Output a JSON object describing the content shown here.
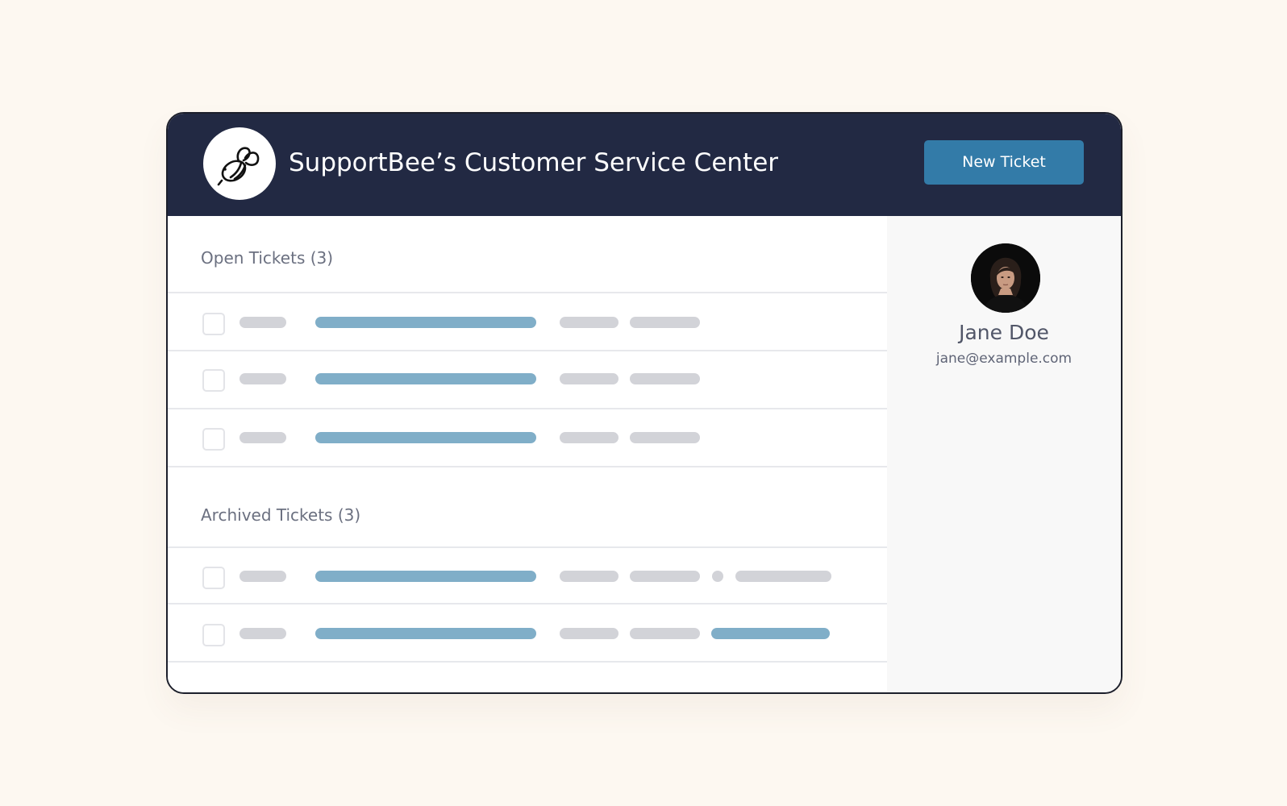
{
  "header": {
    "title": "SupportBee’s Customer Service Center",
    "new_ticket_label": "New Ticket",
    "logo_icon": "bee-icon",
    "background_color": "#222943",
    "button_color": "#337ba8"
  },
  "sections": {
    "open": {
      "title": "Open Tickets (3)"
    },
    "archived": {
      "title": "Archived Tickets (3)"
    }
  },
  "user": {
    "name": "Jane Doe",
    "email": "jane@example.com",
    "avatar_icon": "user-avatar"
  },
  "colors": {
    "page_background": "#fdf8f1",
    "placeholder_gray": "#d2d3d8",
    "placeholder_blue": "#80aec8",
    "sidebar_background": "#f8f8f8"
  }
}
